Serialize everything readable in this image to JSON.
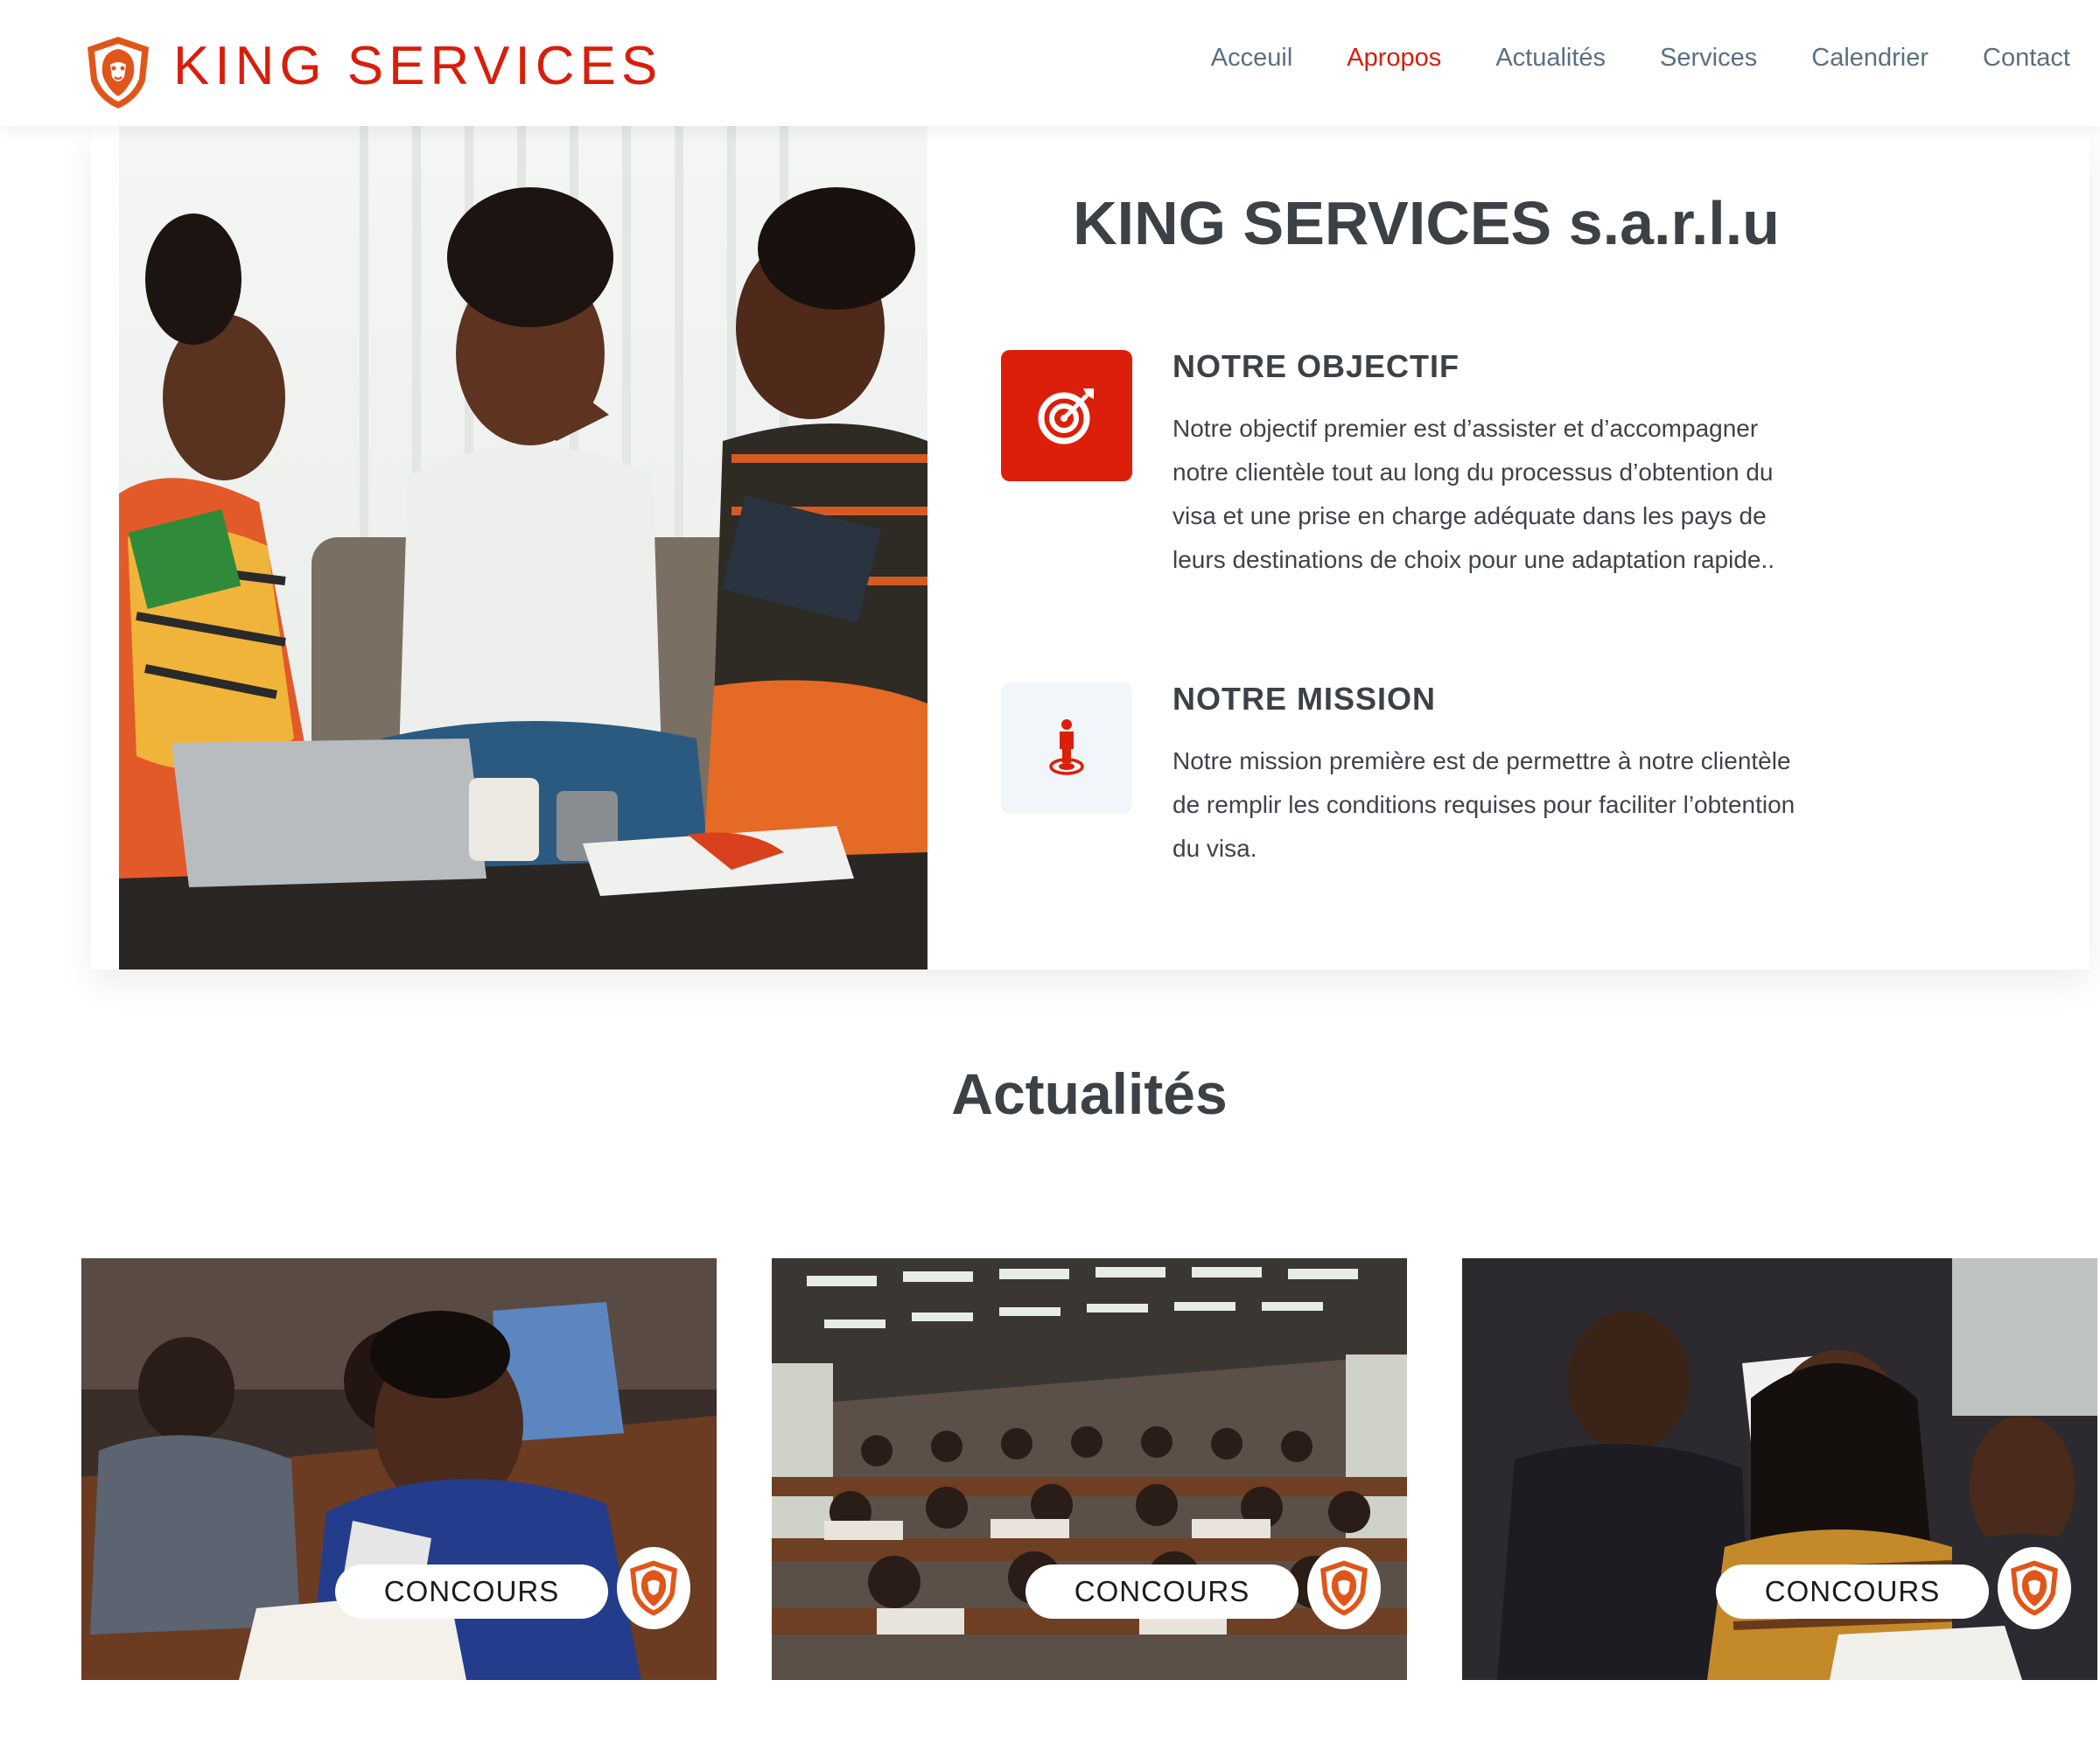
{
  "brand": {
    "name": "KING SERVICES",
    "color": "#d81e0b"
  },
  "nav": {
    "items": [
      {
        "label": "Acceuil",
        "active": false
      },
      {
        "label": "Apropos",
        "active": true
      },
      {
        "label": "Actualités",
        "active": false
      },
      {
        "label": "Services",
        "active": false
      },
      {
        "label": "Calendrier",
        "active": false
      },
      {
        "label": "Contact",
        "active": false
      }
    ]
  },
  "about": {
    "title": "KING SERVICES s.a.r.l.u",
    "objective": {
      "icon": "target-icon",
      "title": "NOTRE OBJECTIF",
      "lines": [
        "Notre objectif premier est d’assister et d’accompagner",
        "notre clientèle tout au long du processus d’obtention du",
        "visa et une prise en charge adéquate dans les pays de",
        "leurs destinations de choix pour une adaptation rapide.."
      ]
    },
    "mission": {
      "icon": "person-target-icon",
      "title": "NOTRE MISSION",
      "lines": [
        "Notre mission première est de permettre à notre clientèle",
        "de remplir les conditions requises pour faciliter l’obtention",
        "du visa."
      ]
    }
  },
  "news": {
    "title": "Actualités",
    "cards": [
      {
        "tag": "CONCOURS"
      },
      {
        "tag": "CONCOURS"
      },
      {
        "tag": "CONCOURS"
      }
    ]
  },
  "colors": {
    "accent": "#dc1f0a",
    "heading": "#3c4146",
    "nav": "#5a6f82",
    "icon_bg_light": "#f1f6fa"
  }
}
